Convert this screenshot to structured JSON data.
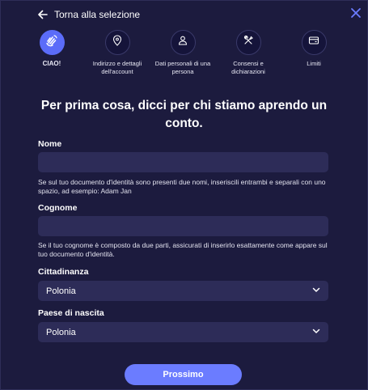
{
  "header": {
    "back_label": "Torna alla selezione"
  },
  "steps": [
    {
      "label": "CIAO!",
      "icon": "wave-hand-icon",
      "active": true
    },
    {
      "label": "Indirizzo e dettagli dell'account",
      "icon": "location-pin-icon",
      "active": false
    },
    {
      "label": "Dati personali di una persona",
      "icon": "person-icon",
      "active": false
    },
    {
      "label": "Consensi e dichiarazioni",
      "icon": "tools-icon",
      "active": false
    },
    {
      "label": "Limiti",
      "icon": "card-icon",
      "active": false
    }
  ],
  "heading": "Per prima cosa, dicci per chi stiamo aprendo un conto.",
  "form": {
    "nome": {
      "label": "Nome",
      "value": "",
      "hint": "Se sul tuo documento d'identità sono presenti due nomi, inseriscili entrambi e separali con uno spazio, ad esempio: Adam Jan"
    },
    "cognome": {
      "label": "Cognome",
      "value": "",
      "hint": "Se il tuo cognome è composto da due parti, assicurati di inserirlo esattamente come appare sul tuo documento d'identità."
    },
    "cittadinanza": {
      "label": "Cittadinanza",
      "value": "Polonia"
    },
    "paese_nascita": {
      "label": "Paese di nascita",
      "value": "Polonia"
    }
  },
  "actions": {
    "next_label": "Prossimo"
  },
  "colors": {
    "background": "#1c1b3e",
    "field": "#2d2c58",
    "accent": "#5b6cf9",
    "button": "#6b7cff",
    "close_icon": "#6b7cff"
  }
}
